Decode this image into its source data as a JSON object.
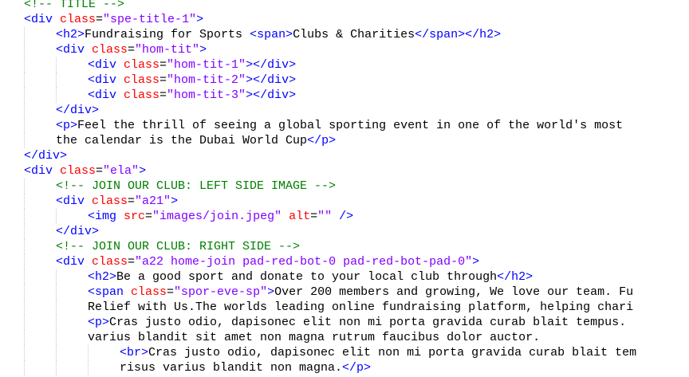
{
  "editor": {
    "colors": {
      "text": "#000000",
      "tag": "#0000ff",
      "attr": "#ff0000",
      "value": "#8000ff",
      "comment": "#008000"
    },
    "lines": [
      {
        "indent": 0,
        "tokens": [
          {
            "t": "<!-- TITLE -->",
            "c": "comment"
          }
        ]
      },
      {
        "indent": 0,
        "tokens": [
          {
            "t": "<div",
            "c": "tag"
          },
          {
            "t": " class",
            "c": "attr"
          },
          {
            "t": "=",
            "c": "text"
          },
          {
            "t": "\"spe-title-1\"",
            "c": "value"
          },
          {
            "t": ">",
            "c": "tag"
          }
        ]
      },
      {
        "indent": 1,
        "tokens": [
          {
            "t": "<h2>",
            "c": "tag"
          },
          {
            "t": "Fundraising for Sports ",
            "c": "text"
          },
          {
            "t": "<span>",
            "c": "tag"
          },
          {
            "t": "Clubs & Charities",
            "c": "text"
          },
          {
            "t": "</span></h2>",
            "c": "tag"
          }
        ]
      },
      {
        "indent": 1,
        "tokens": [
          {
            "t": "<div",
            "c": "tag"
          },
          {
            "t": " class",
            "c": "attr"
          },
          {
            "t": "=",
            "c": "text"
          },
          {
            "t": "\"hom-tit\"",
            "c": "value"
          },
          {
            "t": ">",
            "c": "tag"
          }
        ]
      },
      {
        "indent": 2,
        "tokens": [
          {
            "t": "<div",
            "c": "tag"
          },
          {
            "t": " class",
            "c": "attr"
          },
          {
            "t": "=",
            "c": "text"
          },
          {
            "t": "\"hom-tit-1\"",
            "c": "value"
          },
          {
            "t": "></div>",
            "c": "tag"
          }
        ]
      },
      {
        "indent": 2,
        "tokens": [
          {
            "t": "<div",
            "c": "tag"
          },
          {
            "t": " class",
            "c": "attr"
          },
          {
            "t": "=",
            "c": "text"
          },
          {
            "t": "\"hom-tit-2\"",
            "c": "value"
          },
          {
            "t": "></div>",
            "c": "tag"
          }
        ]
      },
      {
        "indent": 2,
        "tokens": [
          {
            "t": "<div",
            "c": "tag"
          },
          {
            "t": " class",
            "c": "attr"
          },
          {
            "t": "=",
            "c": "text"
          },
          {
            "t": "\"hom-tit-3\"",
            "c": "value"
          },
          {
            "t": "></div>",
            "c": "tag"
          }
        ]
      },
      {
        "indent": 1,
        "tokens": [
          {
            "t": "</div>",
            "c": "tag"
          }
        ]
      },
      {
        "indent": 1,
        "tokens": [
          {
            "t": "<p>",
            "c": "tag"
          },
          {
            "t": "Feel the thrill of seeing a global sporting event in one of the world's most",
            "c": "text"
          }
        ]
      },
      {
        "indent": 1,
        "tokens": [
          {
            "t": "the calendar is the Dubai World Cup",
            "c": "text"
          },
          {
            "t": "</p>",
            "c": "tag"
          }
        ]
      },
      {
        "indent": 0,
        "tokens": [
          {
            "t": "</div>",
            "c": "tag"
          }
        ]
      },
      {
        "indent": 0,
        "tokens": [
          {
            "t": "<div",
            "c": "tag"
          },
          {
            "t": " class",
            "c": "attr"
          },
          {
            "t": "=",
            "c": "text"
          },
          {
            "t": "\"ela\"",
            "c": "value"
          },
          {
            "t": ">",
            "c": "tag"
          }
        ]
      },
      {
        "indent": 1,
        "tokens": [
          {
            "t": "<!-- JOIN OUR CLUB: LEFT SIDE IMAGE -->",
            "c": "comment"
          }
        ]
      },
      {
        "indent": 1,
        "tokens": [
          {
            "t": "<div",
            "c": "tag"
          },
          {
            "t": " class",
            "c": "attr"
          },
          {
            "t": "=",
            "c": "text"
          },
          {
            "t": "\"a21\"",
            "c": "value"
          },
          {
            "t": ">",
            "c": "tag"
          }
        ]
      },
      {
        "indent": 2,
        "tokens": [
          {
            "t": "<img",
            "c": "tag"
          },
          {
            "t": " src",
            "c": "attr"
          },
          {
            "t": "=",
            "c": "text"
          },
          {
            "t": "\"images/join.jpeg\"",
            "c": "value"
          },
          {
            "t": " alt",
            "c": "attr"
          },
          {
            "t": "=",
            "c": "text"
          },
          {
            "t": "\"\"",
            "c": "value"
          },
          {
            "t": " />",
            "c": "tag"
          }
        ]
      },
      {
        "indent": 1,
        "tokens": [
          {
            "t": "</div>",
            "c": "tag"
          }
        ]
      },
      {
        "indent": 1,
        "tokens": [
          {
            "t": "<!-- JOIN OUR CLUB: RIGHT SIDE -->",
            "c": "comment"
          }
        ]
      },
      {
        "indent": 1,
        "tokens": [
          {
            "t": "<div",
            "c": "tag"
          },
          {
            "t": " class",
            "c": "attr"
          },
          {
            "t": "=",
            "c": "text"
          },
          {
            "t": "\"a22 home-join pad-red-bot-0 pad-red-bot-pad-0\"",
            "c": "value"
          },
          {
            "t": ">",
            "c": "tag"
          }
        ]
      },
      {
        "indent": 2,
        "tokens": [
          {
            "t": "<h2>",
            "c": "tag"
          },
          {
            "t": "Be a good sport and donate to your local club through",
            "c": "text"
          },
          {
            "t": "</h2>",
            "c": "tag"
          }
        ]
      },
      {
        "indent": 2,
        "tokens": [
          {
            "t": "<span",
            "c": "tag"
          },
          {
            "t": " class",
            "c": "attr"
          },
          {
            "t": "=",
            "c": "text"
          },
          {
            "t": "\"spor-eve-sp\"",
            "c": "value"
          },
          {
            "t": ">",
            "c": "tag"
          },
          {
            "t": "Over 200 members and growing, We love our team. Fu",
            "c": "text"
          }
        ]
      },
      {
        "indent": 2,
        "tokens": [
          {
            "t": "Relief with Us.The worlds leading online fundraising platform, helping chari",
            "c": "text"
          }
        ]
      },
      {
        "indent": 2,
        "tokens": [
          {
            "t": "<p>",
            "c": "tag"
          },
          {
            "t": "Cras justo odio, dapisonec elit non mi porta gravida curab blait tempus.",
            "c": "text"
          }
        ]
      },
      {
        "indent": 2,
        "tokens": [
          {
            "t": "varius blandit sit amet non magna rutrum faucibus dolor auctor.",
            "c": "text"
          }
        ]
      },
      {
        "indent": 3,
        "tokens": [
          {
            "t": "<br>",
            "c": "tag"
          },
          {
            "t": "Cras justo odio, dapisonec elit non mi porta gravida curab blait tem",
            "c": "text"
          }
        ]
      },
      {
        "indent": 3,
        "tokens": [
          {
            "t": "risus varius blandit non magna.",
            "c": "text"
          },
          {
            "t": "</p>",
            "c": "tag"
          }
        ]
      }
    ]
  }
}
